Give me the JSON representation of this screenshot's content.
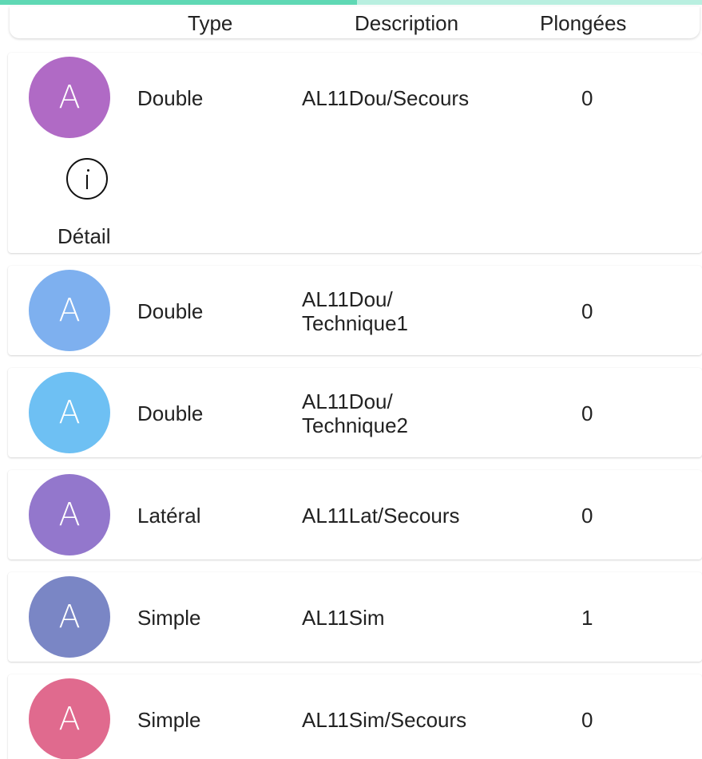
{
  "header": {
    "type_label": "Type",
    "description_label": "Description",
    "plongees_label": "Plongées"
  },
  "accent": {
    "progress_color": "#5fd8b4",
    "track_color": "#b9efe0"
  },
  "rows": [
    {
      "avatar": "A",
      "avatar_color": "#b06ac5",
      "type": "Double",
      "description": "AL11Dou/Secours",
      "plongees": "0",
      "expanded": true,
      "detail_label": "Détail",
      "detail_icon": "info-icon"
    },
    {
      "avatar": "A",
      "avatar_color": "#7eb0ef",
      "type": "Double",
      "description": "AL11Dou/\nTechnique1",
      "plongees": "0"
    },
    {
      "avatar": "A",
      "avatar_color": "#6ec0f3",
      "type": "Double",
      "description": "AL11Dou/\nTechnique2",
      "plongees": "0"
    },
    {
      "avatar": "A",
      "avatar_color": "#9377cc",
      "type": "Latéral",
      "description": "AL11Lat/Secours",
      "plongees": "0"
    },
    {
      "avatar": "A",
      "avatar_color": "#7a86c5",
      "type": "Simple",
      "description": "AL11Sim",
      "plongees": "1"
    },
    {
      "avatar": "A",
      "avatar_color": "#e06a8e",
      "type": "Simple",
      "description": "AL11Sim/Secours",
      "plongees": "0"
    }
  ]
}
